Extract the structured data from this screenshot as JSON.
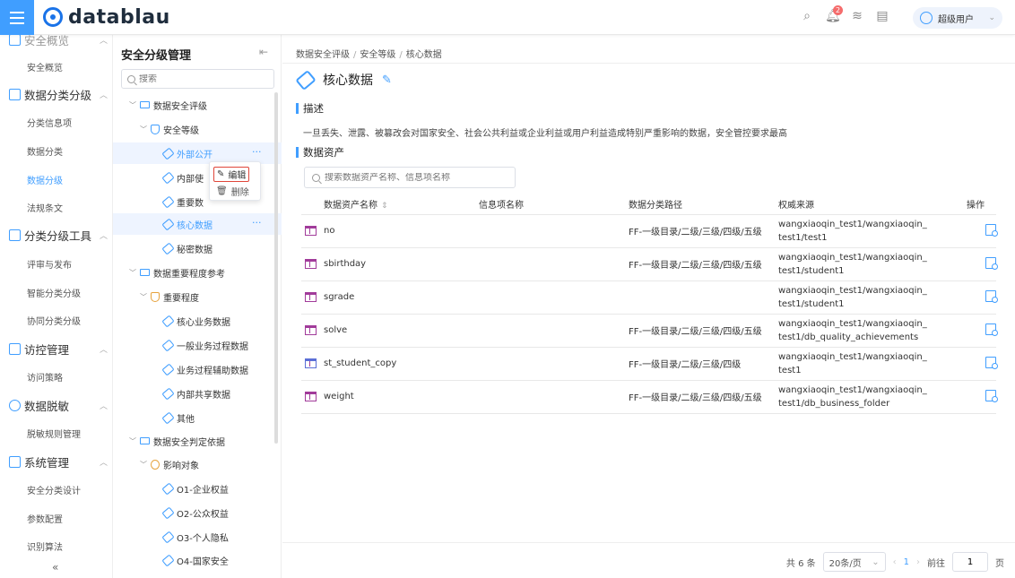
{
  "header": {
    "logo_text": "datablau",
    "notif_count": "2",
    "user_name": "超级用户"
  },
  "nav": {
    "top_group": "安全概览",
    "items": {
      "overview": "安全概览",
      "g_classify": "数据分类分级",
      "classify_info": "分类信息项",
      "data_classify": "数据分类",
      "data_grade": "数据分级",
      "laws": "法规条文",
      "g_tools": "分类分级工具",
      "review": "评审与发布",
      "smart": "智能分类分级",
      "collab": "协同分类分级",
      "g_access": "访控管理",
      "access_policy": "访问策略",
      "g_mask": "数据脱敏",
      "mask_rules": "脱敏规则管理",
      "g_system": "系统管理",
      "sec_design": "安全分类设计",
      "params": "参数配置",
      "algo": "识别算法"
    },
    "collapse": "«"
  },
  "tree": {
    "title": "安全分级管理",
    "search_placeholder": "搜索",
    "nodes": {
      "n1": "数据安全评级",
      "n2": "安全等级",
      "n3": "外部公开",
      "n4": "内部使",
      "n5": "重要数",
      "n6": "核心数据",
      "n7": "秘密数据",
      "n8": "数据重要程度参考",
      "n9": "重要程度",
      "n10": "核心业务数据",
      "n11": "一般业务过程数据",
      "n12": "业务过程辅助数据",
      "n13": "内部共享数据",
      "n14": "其他",
      "n15": "数据安全判定依据",
      "n16": "影响对象",
      "n17": "O1-企业权益",
      "n18": "O2-公众权益",
      "n19": "O3-个人隐私",
      "n20": "O4-国家安全"
    },
    "menu": {
      "edit": "编辑",
      "delete": "删除"
    }
  },
  "main": {
    "breadcrumb": [
      "数据安全评级",
      "安全等级",
      "核心数据"
    ],
    "title": "核心数据",
    "desc_label": "描述",
    "desc_text": "一旦丢失、泄露、被篡改会对国家安全、社会公共利益或企业利益或用户利益造成特别严重影响的数据，安全管控要求最高",
    "assets_label": "数据资产",
    "asset_search_placeholder": "搜索数据资产名称、信息项名称",
    "columns": [
      "数据资产名称",
      "信息项名称",
      "数据分类路径",
      "权威来源",
      "操作"
    ],
    "rows": [
      {
        "name": "no",
        "info": "",
        "path": "FF-一级目录/二级/三级/四级/五级",
        "src1": "wangxiaoqin_test1/wangxiaoqin_",
        "src2": "test1/test1"
      },
      {
        "name": "sbirthday",
        "info": "",
        "path": "FF-一级目录/二级/三级/四级/五级",
        "src1": "wangxiaoqin_test1/wangxiaoqin_",
        "src2": "test1/student1"
      },
      {
        "name": "sgrade",
        "info": "",
        "path": "",
        "src1": "wangxiaoqin_test1/wangxiaoqin_",
        "src2": "test1/student1"
      },
      {
        "name": "solve",
        "info": "",
        "path": "FF-一级目录/二级/三级/四级/五级",
        "src1": "wangxiaoqin_test1/wangxiaoqin_",
        "src2": "test1/db_quality_achievements"
      },
      {
        "name": "st_student_copy",
        "info": "",
        "path": "FF-一级目录/二级/三级/四级",
        "src1": "wangxiaoqin_test1/wangxiaoqin_",
        "src2": "test1"
      },
      {
        "name": "weight",
        "info": "",
        "path": "FF-一级目录/二级/三级/四级/五级",
        "src1": "wangxiaoqin_test1/wangxiaoqin_",
        "src2": "test1/db_business_folder"
      }
    ],
    "pager": {
      "total": "共 6 条",
      "page_size": "20条/页",
      "current": "1",
      "goto": "前往",
      "goto_value": "1",
      "page_suffix": "页"
    }
  }
}
